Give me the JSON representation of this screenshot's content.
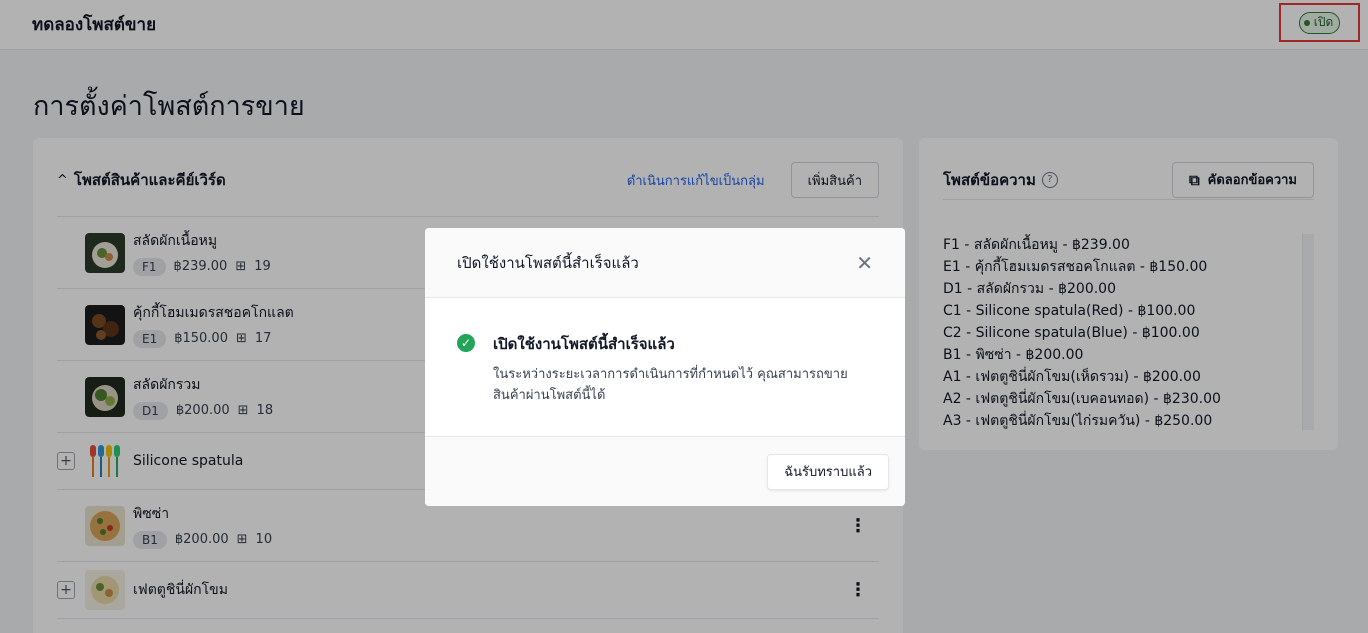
{
  "topbar": {
    "title": "ทดลองโพสต์ขาย",
    "status": "เปิด"
  },
  "page": {
    "title": "การตั้งค่าโพสต์การขาย"
  },
  "products_section": {
    "title": "โพสต์สินค้าและคีย์เวิร์ด",
    "bulk_edit": "ดำเนินการแก้ไขเป็นกลุ่ม",
    "add_product": "เพิ่มสินค้า",
    "items": [
      {
        "name": "สลัดผักเนื้อหมู",
        "code": "F1",
        "price": "฿239.00",
        "stock": "19"
      },
      {
        "name": "คุ้กกี้โฮมเมดรสชอคโกแลต",
        "code": "E1",
        "price": "฿150.00",
        "stock": "17"
      },
      {
        "name": "สลัดผักรวม",
        "code": "D1",
        "price": "฿200.00",
        "stock": "18"
      },
      {
        "name": "Silicone spatula"
      },
      {
        "name": "พิซซ่า",
        "code": "B1",
        "price": "฿200.00",
        "stock": "10"
      },
      {
        "name": "เฟตตูชินี่ผักโขม"
      }
    ]
  },
  "post_text_section": {
    "title": "โพสต์ข้อความ",
    "copy_button": "คัดลอกข้อความ",
    "lines": [
      "F1 - สลัดผักเนื้อหมู - ฿239.00",
      "E1 - คุ้กกี้โฮมเมดรสชอคโกแลต - ฿150.00",
      "D1 - สลัดผักรวม - ฿200.00",
      "C1 - Silicone spatula(Red) - ฿100.00",
      "C2 - Silicone spatula(Blue) - ฿100.00",
      "B1 - พิซซ่า - ฿200.00",
      "A1 - เฟตตูชินี่ผักโขม(เห็ดรวม) - ฿200.00",
      "A2 - เฟตตูชินี่ผักโขม(เบคอนทอด) - ฿230.00",
      "A3 - เฟตตูชินี่ผักโขม(ไก่รมควัน) - ฿250.00"
    ]
  },
  "modal": {
    "title": "เปิดใช้งานโพสต์นี้สำเร็จแล้ว",
    "message_title": "เปิดใช้งานโพสต์นี้สำเร็จแล้ว",
    "message_body": "ในระหว่างระยะเวลาการดำเนินการที่กำหนดไว้ คุณสามารถขายสินค้าผ่านโพสต์นี้ได้",
    "ack_button": "ฉันรับทราบแล้ว"
  },
  "colors": {
    "success": "#22a55a",
    "link": "#2563eb",
    "highlight": "#e53935"
  }
}
